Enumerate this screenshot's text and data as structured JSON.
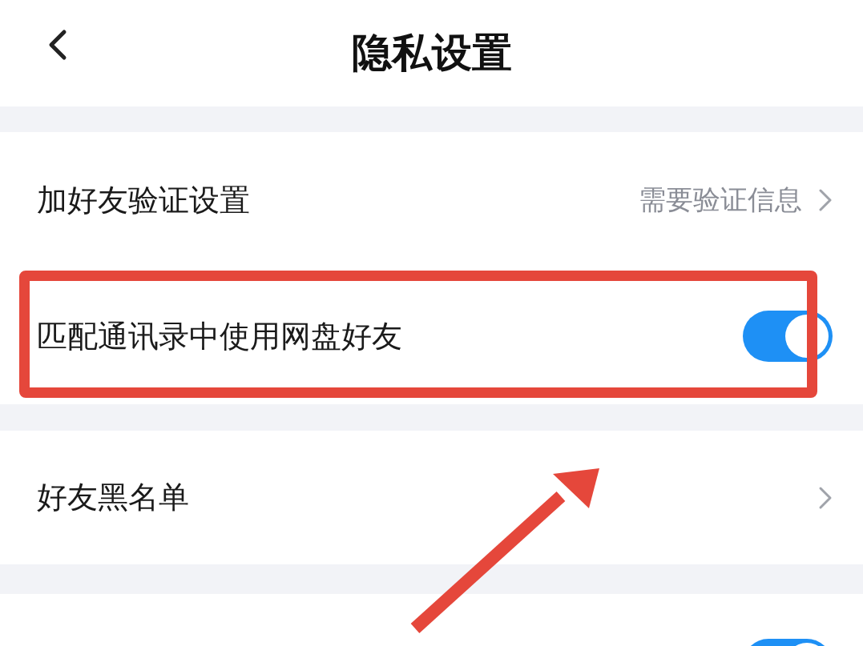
{
  "header": {
    "title": "隐私设置"
  },
  "groups": [
    {
      "rows": [
        {
          "kind": "link",
          "label": "加好友验证设置",
          "value": "需要验证信息"
        },
        {
          "kind": "toggle",
          "label": "匹配通讯录中使用网盘好友",
          "on": true
        }
      ]
    },
    {
      "rows": [
        {
          "kind": "link",
          "label": "好友黑名单"
        }
      ]
    },
    {
      "rows": [
        {
          "kind": "toggle",
          "on": true
        }
      ]
    }
  ],
  "annotations": {
    "highlight_frame": true,
    "pointer_arrow": true
  }
}
